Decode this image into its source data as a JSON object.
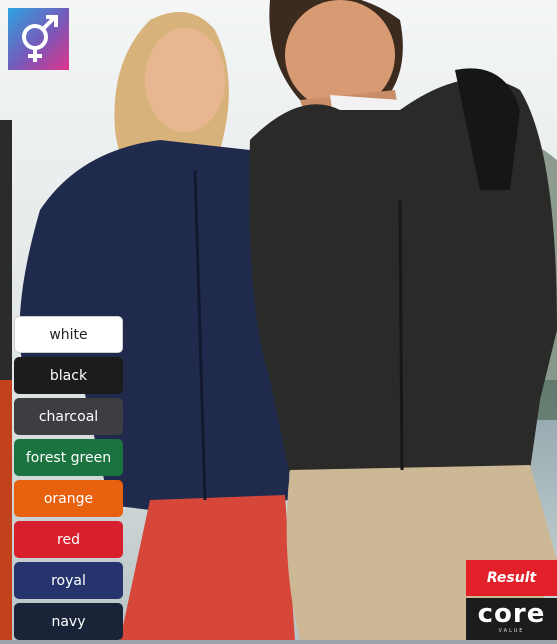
{
  "badge": {
    "icon": "male-female-symbol-icon"
  },
  "colours": [
    {
      "label": "white",
      "hex": "#ffffff"
    },
    {
      "label": "black",
      "hex": "#1c1c1c"
    },
    {
      "label": "charcoal",
      "hex": "#3c3e41"
    },
    {
      "label": "forest green",
      "hex": "#1b7440"
    },
    {
      "label": "orange",
      "hex": "#e8610f"
    },
    {
      "label": "red",
      "hex": "#d81f2e"
    },
    {
      "label": "royal",
      "hex": "#26346e"
    },
    {
      "label": "navy",
      "hex": "#1a2438"
    }
  ],
  "brand": {
    "result_logo_text": "Result",
    "core_logo_text": "core",
    "core_logo_subtext": "VALUE"
  }
}
